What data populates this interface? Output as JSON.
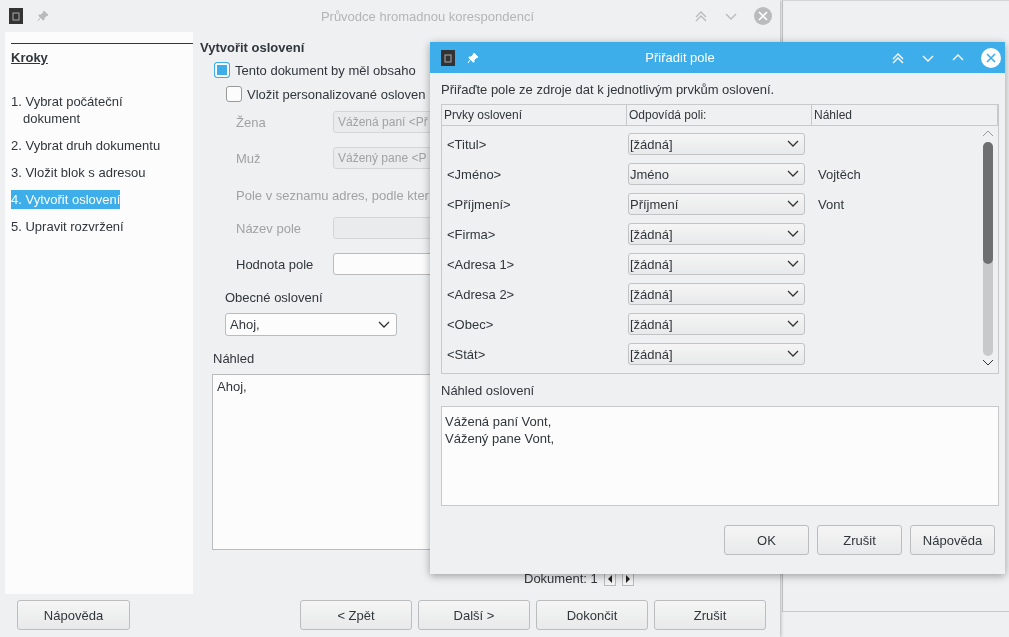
{
  "main_window": {
    "title": "Průvodce hromadnou korespondencí",
    "steps_heading": "Kroky",
    "steps": [
      {
        "label": "1. Vybrat počáteční dokument",
        "selected": false
      },
      {
        "label": "2. Vybrat druh dokumentu",
        "selected": false
      },
      {
        "label": "3. Vložit blok s adresou",
        "selected": false
      },
      {
        "label": "4. Vytvořit oslovení",
        "selected": true
      },
      {
        "label": "5. Upravit rozvržení",
        "selected": false
      }
    ],
    "section_title": "Vytvořit oslovení",
    "options": [
      {
        "label": "Tento dokument by měl obsaho",
        "checked": true
      },
      {
        "label": "Vložit personalizované osloven",
        "checked": false
      }
    ],
    "salutation_fields": [
      {
        "label": "Žena",
        "value": "Vážená paní <Př",
        "disabled": true
      },
      {
        "label": "Muž",
        "value": "Vážený pane <P",
        "disabled": true
      }
    ],
    "field_list_label": "Pole v seznamu adres, podle kter",
    "lookup_fields": [
      {
        "label": "Název pole",
        "disabled": true
      },
      {
        "label": "Hodnota pole",
        "disabled": false
      }
    ],
    "general_label": "Obecné oslovení",
    "general_value": "Ahoj,",
    "preview_label": "Náhled",
    "preview_text": "Ahoj,",
    "document_label": "Dokument: 1",
    "help_button": "Nápověda",
    "nav_buttons": [
      "< Zpět",
      "Další >",
      "Dokončit",
      "Zrušit"
    ]
  },
  "dialog": {
    "title": "Přiřadit pole",
    "instruction": "Přiřaďte pole ze zdroje dat k jednotlivým prvkům oslovení.",
    "columns": [
      "Prvky oslovení",
      "Odpovídá poli:",
      "Náhled"
    ],
    "rows": [
      {
        "element": "<Titul>",
        "field": "[žádná]",
        "preview": ""
      },
      {
        "element": "<Jméno>",
        "field": "Jméno",
        "preview": "Vojtěch"
      },
      {
        "element": "<Příjmení>",
        "field": "Příjmení",
        "preview": "Vont"
      },
      {
        "element": "<Firma>",
        "field": "[žádná]",
        "preview": ""
      },
      {
        "element": "<Adresa 1>",
        "field": "[žádná]",
        "preview": ""
      },
      {
        "element": "<Adresa 2>",
        "field": "[žádná]",
        "preview": ""
      },
      {
        "element": "<Obec>",
        "field": "[žádná]",
        "preview": ""
      },
      {
        "element": "<Stát>",
        "field": "[žádná]",
        "preview": ""
      }
    ],
    "preview_label": "Náhled oslovení",
    "preview_lines": [
      "Vážená paní Vont,",
      "Vážený pane Vont,"
    ],
    "buttons": [
      "OK",
      "Zrušit",
      "Nápověda"
    ]
  }
}
